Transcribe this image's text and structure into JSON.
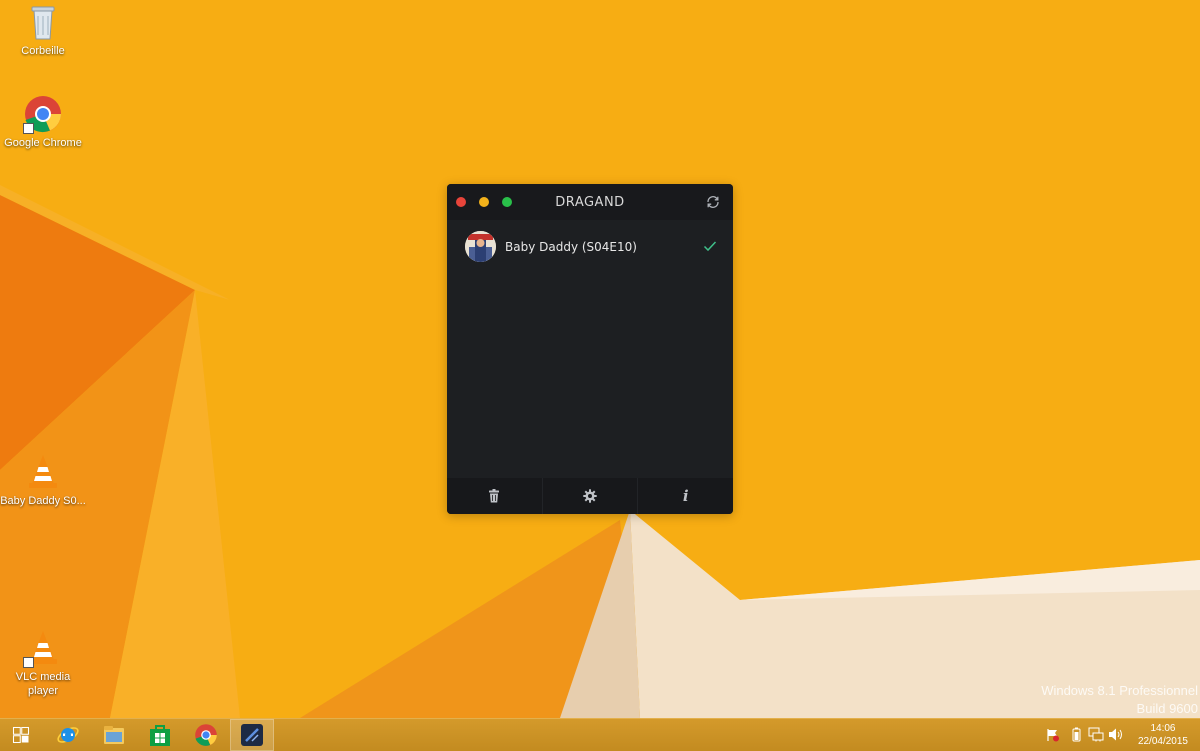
{
  "desktop": {
    "icons": [
      {
        "label": "Corbeille",
        "icon": "recycle-bin-icon"
      },
      {
        "label": "Google Chrome",
        "icon": "chrome-icon"
      },
      {
        "label": "Baby Daddy S0...",
        "icon": "vlc-file-icon"
      },
      {
        "label": "VLC media player",
        "icon": "vlc-icon"
      }
    ],
    "watermark": {
      "line1": "Windows 8.1 Professionnel",
      "line2": "Build 9600"
    },
    "background_color": "#f7ad13"
  },
  "dragand": {
    "title": "DRAGAND",
    "items": [
      {
        "title": "Baby Daddy (S04E10)",
        "status": "done"
      }
    ],
    "footer": {
      "trash_icon": "trash-icon",
      "settings_icon": "gear-icon",
      "info_glyph": "i"
    },
    "colors": {
      "window": "#1d1f22",
      "close": "#e8443a",
      "minimize": "#f3b21b",
      "maximize": "#29c04a",
      "check": "#3fbf8a"
    }
  },
  "taskbar": {
    "apps": [
      "start-icon",
      "internet-explorer-icon",
      "file-explorer-icon",
      "store-icon",
      "chrome-icon",
      "dragand-icon"
    ],
    "clock": {
      "time": "14:06",
      "date": "22/04/2015"
    }
  }
}
